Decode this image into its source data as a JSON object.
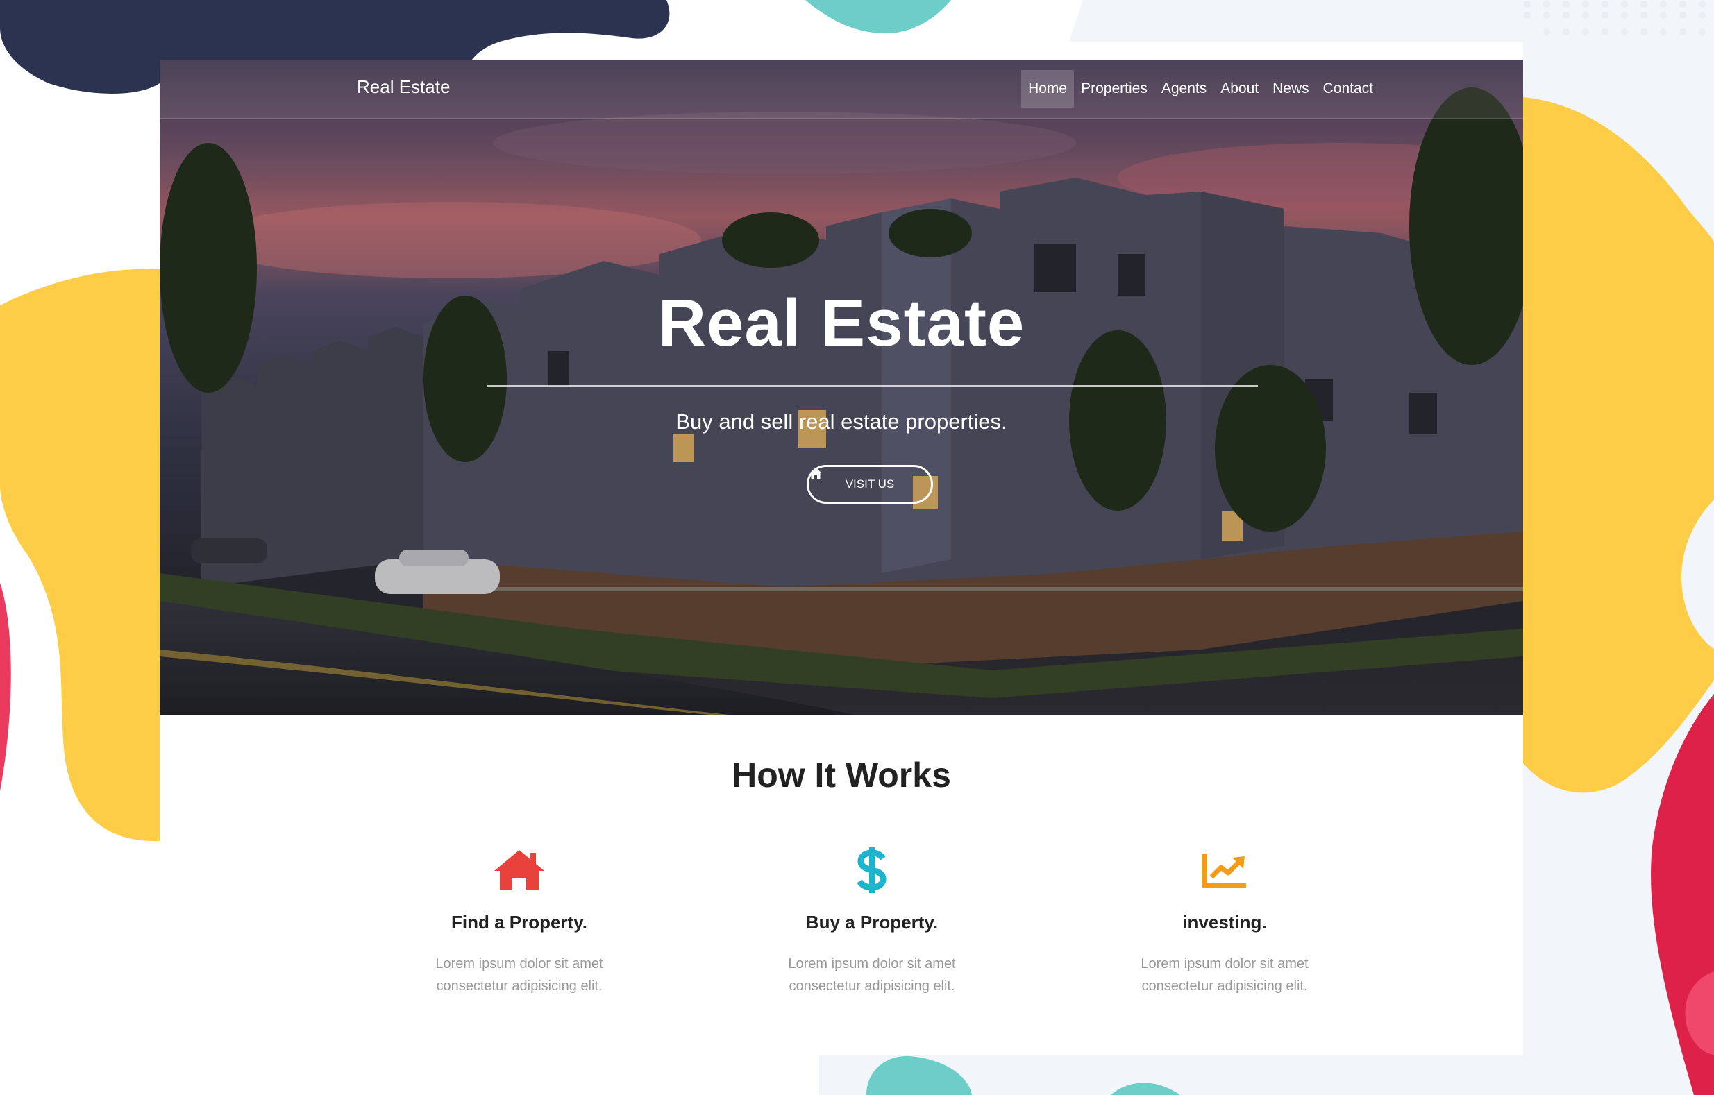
{
  "colors": {
    "navy": "#2c3350",
    "teal": "#6ccdc9",
    "yellow": "#fecd48",
    "red": "#dd2149",
    "pale": "#f2f6fa",
    "icon_red": "#e8413b",
    "icon_teal": "#1bb5ce",
    "icon_orange": "#f59c17",
    "heading": "#222222",
    "muted": "#999999"
  },
  "navbar": {
    "brand": "Real Estate",
    "items": [
      {
        "label": "Home",
        "active": true
      },
      {
        "label": "Properties"
      },
      {
        "label": "Agents"
      },
      {
        "label": "About"
      },
      {
        "label": "News"
      },
      {
        "label": "Contact"
      }
    ]
  },
  "hero": {
    "title": "Real Estate",
    "subtitle": "Buy and sell real estate properties.",
    "button_label": "VISIT US",
    "button_icon": "home-icon"
  },
  "how_it_works": {
    "title": "How It Works",
    "features": [
      {
        "icon": "home-icon",
        "title": "Find a Property.",
        "text": "Lorem ipsum dolor sit amet consectetur adipisicing elit."
      },
      {
        "icon": "dollar-icon",
        "title": "Buy a Property.",
        "text": "Lorem ipsum dolor sit amet consectetur adipisicing elit."
      },
      {
        "icon": "chart-line-icon",
        "title": "investing.",
        "text": "Lorem ipsum dolor sit amet consectetur adipisicing elit."
      }
    ]
  }
}
